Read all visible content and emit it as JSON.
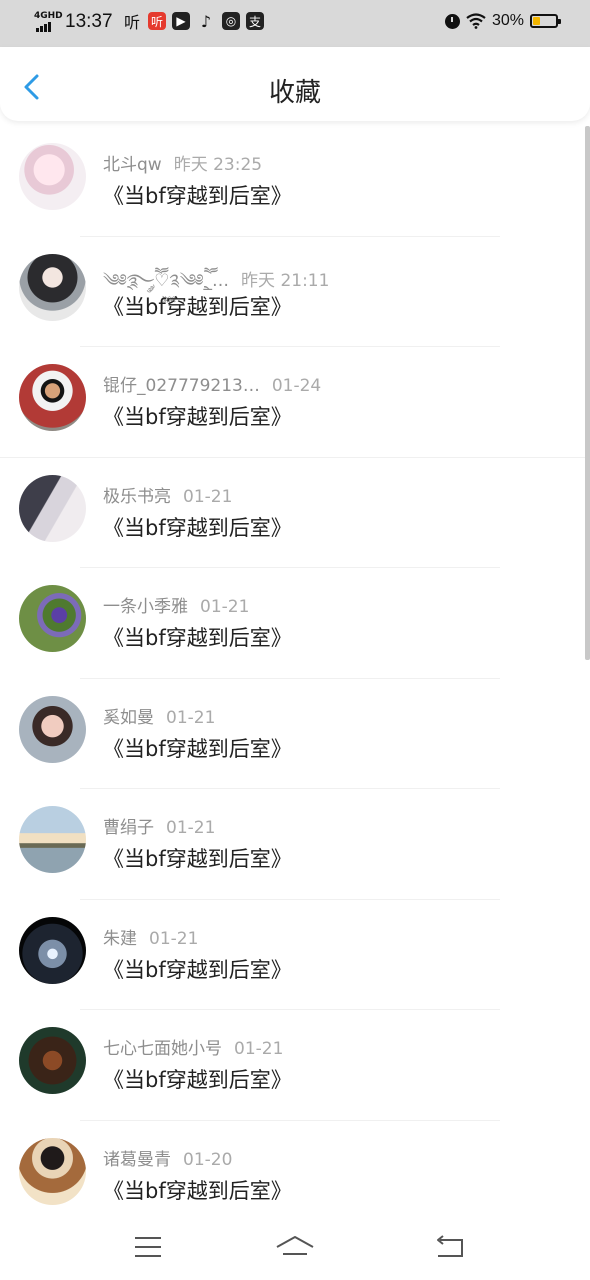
{
  "status_bar": {
    "network": "4GHD",
    "time": "13:37",
    "app_icons": [
      "听",
      "听",
      "video-icon",
      "tiktok-icon",
      "chat-icon",
      "支"
    ],
    "battery_pct": "30%",
    "battery_level": 0.3
  },
  "header": {
    "title": "收藏",
    "back_icon": "chevron-left-icon"
  },
  "favorites": [
    {
      "user": "北斗qw",
      "date": "昨天 23:25",
      "title": "《当bf穿越到后室》",
      "avatar": "avatar-girl-anime-pink"
    },
    {
      "user": "༄༅྄࿐ཽ༘♡༉࿆༄༅྄ཽ_…",
      "date": "昨天 21:11",
      "title": "《当bf穿越到后室》",
      "avatar": "avatar-girl-anime-dark"
    },
    {
      "user": "锟仔_027779213…",
      "date": "01-24",
      "title": "《当bf穿越到后室》",
      "avatar": "avatar-boy-red"
    },
    {
      "user": "极乐书亮",
      "date": "01-21",
      "title": "《当bf穿越到后室》",
      "avatar": "avatar-couple"
    },
    {
      "user": "一条小季雅",
      "date": "01-21",
      "title": "《当bf穿越到后室》",
      "avatar": "avatar-purple-flowers"
    },
    {
      "user": "奚如曼",
      "date": "01-21",
      "title": "《当bf穿越到后室》",
      "avatar": "avatar-girl-selfie"
    },
    {
      "user": "曹绢子",
      "date": "01-21",
      "title": "《当bf穿越到后室》",
      "avatar": "avatar-lake-sunset"
    },
    {
      "user": "朱建",
      "date": "01-21",
      "title": "《当bf穿越到后室》",
      "avatar": "avatar-diamond-dark"
    },
    {
      "user": "七心七面她小号",
      "date": "01-21",
      "title": "《当bf穿越到后室》",
      "avatar": "avatar-arrows-game"
    },
    {
      "user": "诸葛曼青",
      "date": "01-20",
      "title": "《当bf穿越到后室》",
      "avatar": "avatar-girl-hat"
    }
  ],
  "nav": {
    "menu_icon": "menu-icon",
    "home_icon": "home-icon",
    "back_icon": "back-icon"
  },
  "colors": {
    "accent": "#2e9be6",
    "status_bar_bg": "#d9d9d9",
    "username": "#8e8e8e",
    "date": "#aaaaaa",
    "title_text": "#222222",
    "battery": "#f2b500"
  }
}
